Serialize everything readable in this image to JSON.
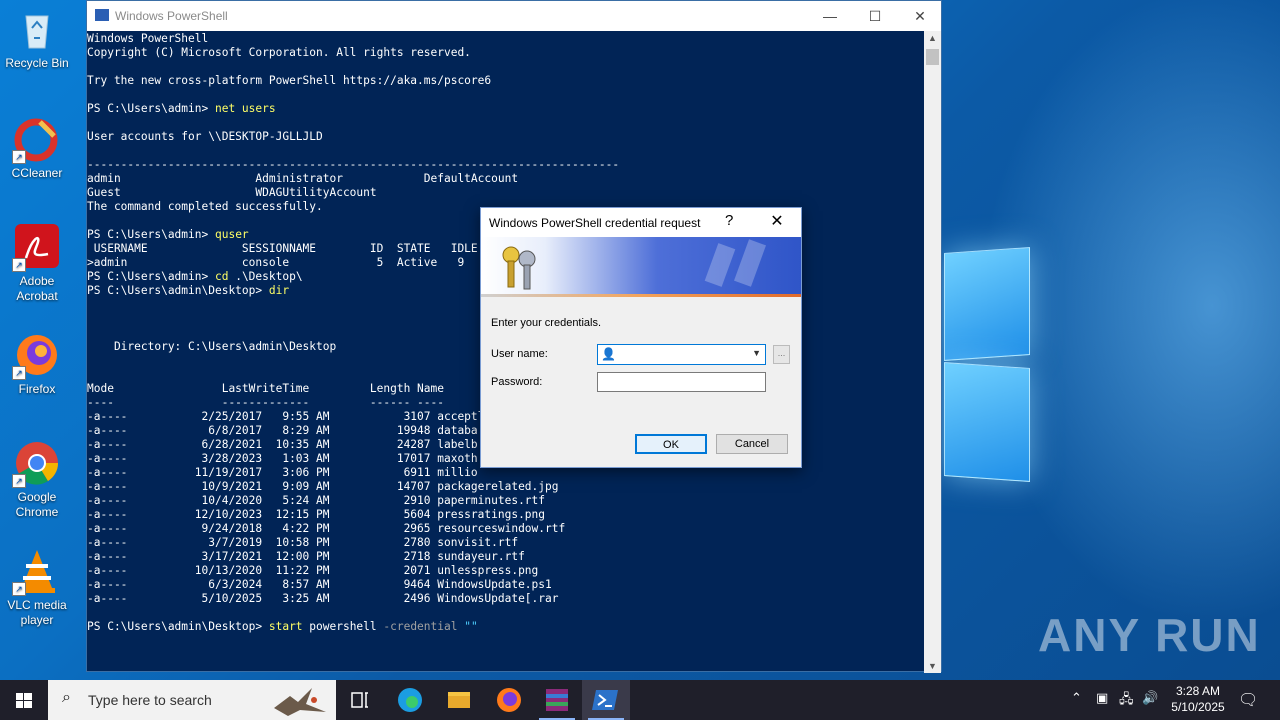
{
  "desktop": {
    "icons": [
      {
        "label": "Recycle Bin",
        "icon": "recycle-bin-icon"
      },
      {
        "label": "CCleaner",
        "icon": "ccleaner-icon"
      },
      {
        "label": "Adobe Acrobat",
        "icon": "adobe-acrobat-icon"
      },
      {
        "label": "Firefox",
        "icon": "firefox-icon"
      },
      {
        "label": "Google Chrome",
        "icon": "chrome-icon"
      },
      {
        "label": "VLC media player",
        "icon": "vlc-icon"
      }
    ],
    "watermark": "ANY RUN"
  },
  "powershell": {
    "title": "Windows PowerShell",
    "lines": {
      "l1": "Windows PowerShell",
      "l2": "Copyright (C) Microsoft Corporation. All rights reserved.",
      "l3": "Try the new cross-platform PowerShell https://aka.ms/pscore6",
      "prompt1": "PS C:\\Users\\admin> ",
      "cmd1": "net users",
      "l5": "User accounts for \\\\DESKTOP-JGLLJLD",
      "sep": "-------------------------------------------------------------------------------",
      "l7": "admin                    Administrator            DefaultAccount",
      "l8": "Guest                    WDAGUtilityAccount",
      "l9": "The command completed successfully.",
      "prompt2": "PS C:\\Users\\admin> ",
      "cmd2": "quser",
      "l11": " USERNAME              SESSIONNAME        ID  STATE   IDLE TIME  LOGON TIME",
      "l12": ">admin                 console             5  Active   9",
      "prompt3": "PS C:\\Users\\admin> ",
      "cmd3": "cd",
      "arg3": " .\\Desktop\\",
      "prompt4": "PS C:\\Users\\admin\\Desktop> ",
      "cmd4": "dir",
      "l15": "    Directory: C:\\Users\\admin\\Desktop",
      "hdr": "Mode                LastWriteTime         Length Name",
      "hdrsep": "----                -------------         ------ ----",
      "prompt5": "PS C:\\Users\\admin\\Desktop> ",
      "cmd5": "start",
      "arg5a": " powershell ",
      "param5": "-credential",
      "str5": " \"\""
    },
    "files": [
      {
        "mode": "-a----",
        "date": "2/25/2017",
        "time": "9:55 AM",
        "length": "3107",
        "name": "acceptl"
      },
      {
        "mode": "-a----",
        "date": "6/8/2017",
        "time": "8:29 AM",
        "length": "19948",
        "name": "databa"
      },
      {
        "mode": "-a----",
        "date": "6/28/2021",
        "time": "10:35 AM",
        "length": "24287",
        "name": "labelb"
      },
      {
        "mode": "-a----",
        "date": "3/28/2023",
        "time": "1:03 AM",
        "length": "17017",
        "name": "maxoth"
      },
      {
        "mode": "-a----",
        "date": "11/19/2017",
        "time": "3:06 PM",
        "length": "6911",
        "name": "millio"
      },
      {
        "mode": "-a----",
        "date": "10/9/2021",
        "time": "9:09 AM",
        "length": "14707",
        "name": "packagerelated.jpg"
      },
      {
        "mode": "-a----",
        "date": "10/4/2020",
        "time": "5:24 AM",
        "length": "2910",
        "name": "paperminutes.rtf"
      },
      {
        "mode": "-a----",
        "date": "12/10/2023",
        "time": "12:15 PM",
        "length": "5604",
        "name": "pressratings.png"
      },
      {
        "mode": "-a----",
        "date": "9/24/2018",
        "time": "4:22 PM",
        "length": "2965",
        "name": "resourceswindow.rtf"
      },
      {
        "mode": "-a----",
        "date": "3/7/2019",
        "time": "10:58 PM",
        "length": "2780",
        "name": "sonvisit.rtf"
      },
      {
        "mode": "-a----",
        "date": "3/17/2021",
        "time": "12:00 PM",
        "length": "2718",
        "name": "sundayeur.rtf"
      },
      {
        "mode": "-a----",
        "date": "10/13/2020",
        "time": "11:22 PM",
        "length": "2071",
        "name": "unlesspress.png"
      },
      {
        "mode": "-a----",
        "date": "6/3/2024",
        "time": "8:57 AM",
        "length": "9464",
        "name": "WindowsUpdate.ps1"
      },
      {
        "mode": "-a----",
        "date": "5/10/2025",
        "time": "3:25 AM",
        "length": "2496",
        "name": "WindowsUpdate[.rar"
      }
    ]
  },
  "dialog": {
    "title": "Windows PowerShell credential request",
    "help": "?",
    "close": "✕",
    "prompt": "Enter your credentials.",
    "username_label": "User name:",
    "password_label": "Password:",
    "browse": "...",
    "ok": "OK",
    "cancel": "Cancel"
  },
  "taskbar": {
    "search_placeholder": "Type here to search",
    "time": "3:28 AM",
    "date": "5/10/2025",
    "apps": [
      "task-view-icon",
      "edge-icon",
      "file-explorer-icon",
      "firefox-icon",
      "winrar-icon",
      "powershell-icon"
    ]
  }
}
